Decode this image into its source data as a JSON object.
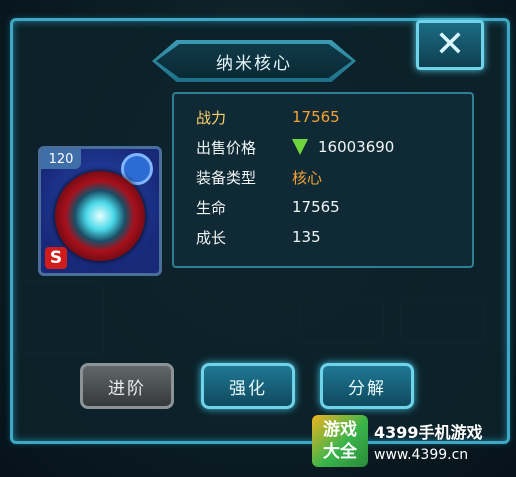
{
  "dialog": {
    "title": "纳米核心",
    "close_label": "✕"
  },
  "item": {
    "level": "120",
    "grade": "S",
    "icon_name": "nano-core-icon"
  },
  "stats": {
    "power_label": "战力",
    "power_value": "17565",
    "price_label": "出售价格",
    "price_value": "16003690",
    "type_label": "装备类型",
    "type_value": "核心",
    "hp_label": "生命",
    "hp_value": "17565",
    "growth_label": "成长",
    "growth_value": "135"
  },
  "buttons": {
    "advance": "进阶",
    "strengthen": "强化",
    "dismantle": "分解"
  },
  "watermark": {
    "logo_line1": "游戏",
    "logo_line2": "大全",
    "title": "4399手机游戏",
    "url": "www.4399.cn"
  },
  "colors": {
    "accent": "#3fa8c4",
    "power_value": "#f6a234",
    "gem": "#6ed63c"
  }
}
